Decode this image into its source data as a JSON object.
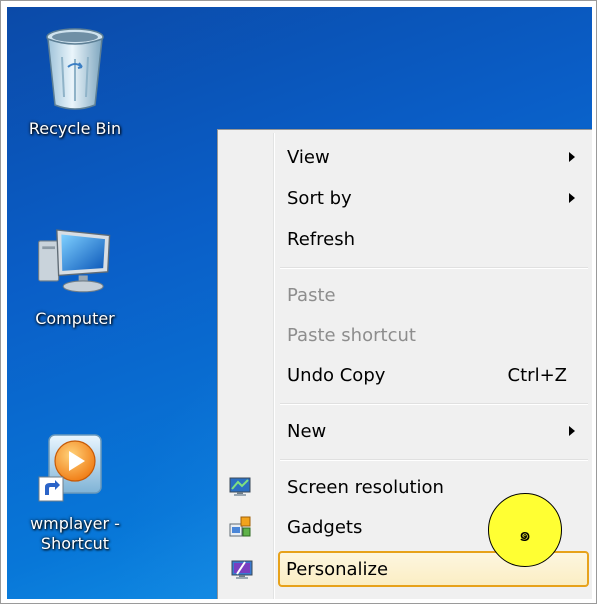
{
  "desktop": {
    "icons": [
      {
        "label": "Recycle Bin",
        "icon": "recycle-bin-icon"
      },
      {
        "label": "Computer",
        "icon": "computer-icon"
      },
      {
        "label": "wmplayer -\nShortcut",
        "icon": "windows-media-player-icon"
      }
    ]
  },
  "context_menu": {
    "items": [
      {
        "label": "View",
        "submenu": true
      },
      {
        "label": "Sort by",
        "submenu": true
      },
      {
        "label": "Refresh"
      },
      {
        "label": "Paste",
        "disabled": true
      },
      {
        "label": "Paste shortcut",
        "disabled": true
      },
      {
        "label": "Undo Copy",
        "shortcut": "Ctrl+Z"
      },
      {
        "label": "New",
        "submenu": true
      },
      {
        "label": "Screen resolution",
        "icon": "screen-resolution-icon"
      },
      {
        "label": "Gadgets",
        "icon": "gadgets-icon"
      },
      {
        "label": "Personalize",
        "icon": "personalize-icon",
        "highlighted": true
      }
    ]
  },
  "annotation": {
    "label": "๑",
    "color": "#ffff33"
  },
  "colors": {
    "highlight_border": "#e7a21b",
    "disabled_text": "#8d8d8d"
  }
}
